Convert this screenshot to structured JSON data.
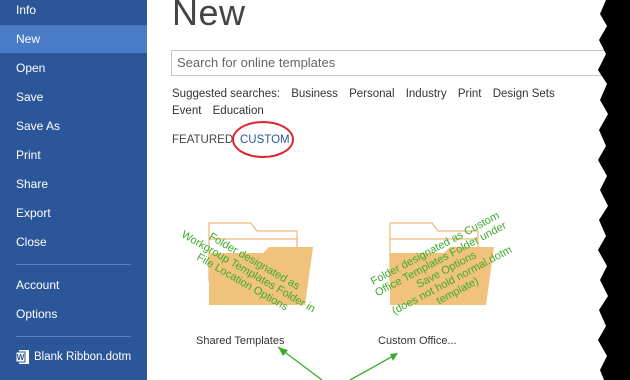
{
  "sidebar": {
    "items": [
      {
        "label": "Info"
      },
      {
        "label": "New"
      },
      {
        "label": "Open"
      },
      {
        "label": "Save"
      },
      {
        "label": "Save As"
      },
      {
        "label": "Print"
      },
      {
        "label": "Share"
      },
      {
        "label": "Export"
      },
      {
        "label": "Close"
      },
      {
        "label": "Account"
      },
      {
        "label": "Options"
      }
    ],
    "recent_file": "Blank Ribbon.dotm"
  },
  "main": {
    "title": "New",
    "search_placeholder": "Search for online templates",
    "suggested_label": "Suggested searches:",
    "suggested": [
      "Business",
      "Personal",
      "Industry",
      "Print",
      "Design Sets",
      "Event",
      "Education"
    ],
    "tabs": {
      "featured": "FEATURED",
      "custom": "CUSTOM"
    },
    "folders": [
      {
        "label": "Shared Templates"
      },
      {
        "label": "Custom Office..."
      }
    ]
  },
  "annotations": {
    "left": [
      "Folder designated as",
      "Workgroup Templates Folder in",
      "File Location Options"
    ],
    "right": [
      "Folder designated as Custom",
      "Office Templates Folder under",
      "Save Options",
      "(does not hold normal.dotm",
      "template)"
    ]
  },
  "colors": {
    "sidebar": "#2b579a",
    "active": "#4a7bc6",
    "accent": "#2b579a",
    "annotation": "#3cab2d",
    "circle": "#e0242a",
    "folder": "#f0c27b"
  }
}
